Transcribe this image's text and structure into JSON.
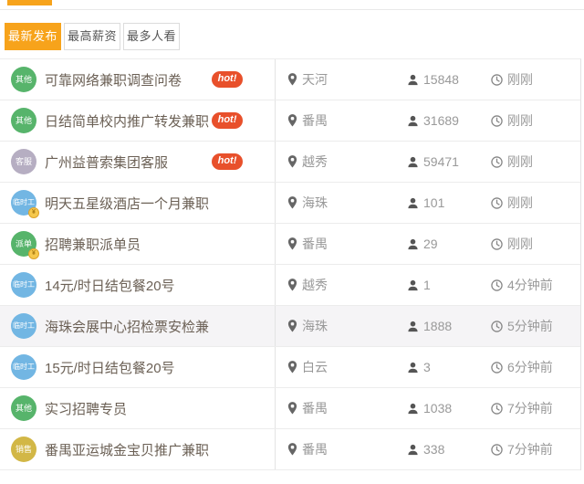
{
  "header": {
    "has_accent_dash": true
  },
  "tabs": {
    "items": [
      {
        "label": "最新发布",
        "active": true
      },
      {
        "label": "最高薪资",
        "active": false
      },
      {
        "label": "最多人看",
        "active": false
      }
    ]
  },
  "badges": {
    "hot_label": "hot!",
    "vip_label": "¥"
  },
  "colors": {
    "tab_active_bg": "#f7a31b",
    "hot_bg": "#e8502b",
    "title_text": "#6b6055",
    "meta_text": "#999999",
    "row_border": "#ececec",
    "highlight_bg": "#f5f4f6",
    "category_green": "#57b46b",
    "category_blue": "#72b6e3",
    "category_lavender": "#b6aec2",
    "category_gold": "#d2b746",
    "vip_gold": "#f6c84c"
  },
  "table": {
    "rows": [
      {
        "category": "其他",
        "category_color": "green",
        "title": "可靠网络兼职调查问卷",
        "hot": true,
        "vip": false,
        "location": "天河",
        "views": "15848",
        "time": "刚刚",
        "highlighted": false
      },
      {
        "category": "其他",
        "category_color": "green",
        "title": "日结简单校内推广转发兼职",
        "hot": true,
        "vip": false,
        "location": "番禺",
        "views": "31689",
        "time": "刚刚",
        "highlighted": false
      },
      {
        "category": "客服",
        "category_color": "lavender",
        "title": "广州益普索集团客服",
        "hot": true,
        "vip": false,
        "location": "越秀",
        "views": "59471",
        "time": "刚刚",
        "highlighted": false
      },
      {
        "category": "临时工",
        "category_color": "blue",
        "title": "明天五星级酒店一个月兼职",
        "hot": false,
        "vip": true,
        "location": "海珠",
        "views": "101",
        "time": "刚刚",
        "highlighted": false
      },
      {
        "category": "派单",
        "category_color": "green",
        "title": "招聘兼职派单员",
        "hot": false,
        "vip": true,
        "location": "番禺",
        "views": "29",
        "time": "刚刚",
        "highlighted": false
      },
      {
        "category": "临时工",
        "category_color": "blue",
        "title": "14元/时日结包餐20号",
        "hot": false,
        "vip": false,
        "location": "越秀",
        "views": "1",
        "time": "4分钟前",
        "highlighted": false
      },
      {
        "category": "临时工",
        "category_color": "blue",
        "title": "海珠会展中心招检票安检兼",
        "hot": false,
        "vip": false,
        "location": "海珠",
        "views": "1888",
        "time": "5分钟前",
        "highlighted": true
      },
      {
        "category": "临时工",
        "category_color": "blue",
        "title": "15元/时日结包餐20号",
        "hot": false,
        "vip": false,
        "location": "白云",
        "views": "3",
        "time": "6分钟前",
        "highlighted": false
      },
      {
        "category": "其他",
        "category_color": "green",
        "title": "实习招聘专员",
        "hot": false,
        "vip": false,
        "location": "番禺",
        "views": "1038",
        "time": "7分钟前",
        "highlighted": false
      },
      {
        "category": "销售",
        "category_color": "gold",
        "title": "番禺亚运城金宝贝推广兼职",
        "hot": false,
        "vip": false,
        "location": "番禺",
        "views": "338",
        "time": "7分钟前",
        "highlighted": false
      }
    ]
  }
}
